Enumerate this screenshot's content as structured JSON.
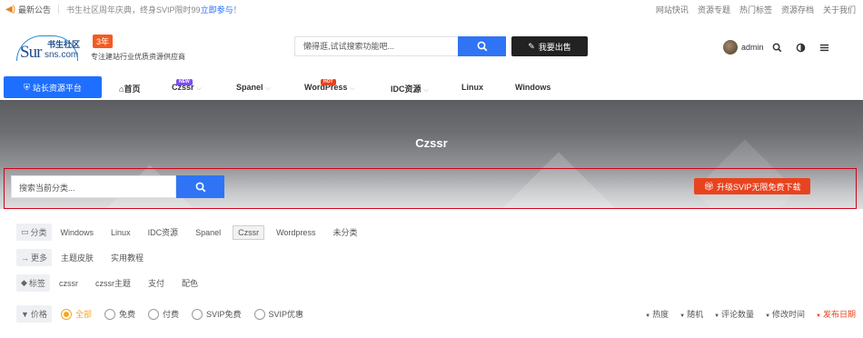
{
  "topbar": {
    "announcement": "最新公告",
    "notice_text": "书生社区周年庆典，终身SVIP限时99",
    "notice_link": "立即参与",
    "notice_suffix": "！",
    "links": [
      "网站快讯",
      "资源专题",
      "热门标签",
      "资源存档",
      "关于我们"
    ]
  },
  "header": {
    "logo": {
      "main": "Sur",
      "sub": "sns.com",
      "cn": "书生社区"
    },
    "year_badge": "3年",
    "slogan": "专注建站行业优质资源供应商",
    "search_placeholder": "懒得逛,试试搜索功能吧...",
    "sell_button": "我要出售",
    "username": "admin"
  },
  "nav": {
    "home_button": "站长资源平台",
    "items": [
      {
        "label": "首页",
        "badge": ""
      },
      {
        "label": "Czssr",
        "badge": "NEW"
      },
      {
        "label": "Spanel",
        "badge": ""
      },
      {
        "label": "WordPress",
        "badge": "HOT"
      },
      {
        "label": "IDC资源",
        "badge": ""
      },
      {
        "label": "Linux",
        "badge": ""
      },
      {
        "label": "Windows",
        "badge": ""
      }
    ]
  },
  "hero": {
    "title": "Czssr",
    "search_placeholder": "搜索当前分类...",
    "upgrade_button": "升级SVIP无限免费下载"
  },
  "filters": {
    "category_label": "分类",
    "categories": [
      "Windows",
      "Linux",
      "IDC资源",
      "Spanel",
      "Czssr",
      "Wordpress",
      "未分类"
    ],
    "active_category": "Czssr",
    "more_label": "更多",
    "more_items": [
      "主题皮肤",
      "实用教程"
    ],
    "tag_label": "标签",
    "tags": [
      "czssr",
      "czssr主题",
      "支付",
      "配色"
    ],
    "price_label": "价格",
    "prices": [
      "全部",
      "免费",
      "付费",
      "SVIP免费",
      "SVIP优惠"
    ],
    "selected_price": "全部",
    "sorts": [
      "热度",
      "随机",
      "评论数量",
      "修改时间",
      "发布日期"
    ],
    "active_sort": "发布日期"
  },
  "colors": {
    "accent": "#1e6fff",
    "search_button": "#2f74f5",
    "upgrade": "#e8431e",
    "badge_hot": "#e8431e",
    "badge_new": "#7b4ff0",
    "radio_selected": "#f5a623"
  }
}
